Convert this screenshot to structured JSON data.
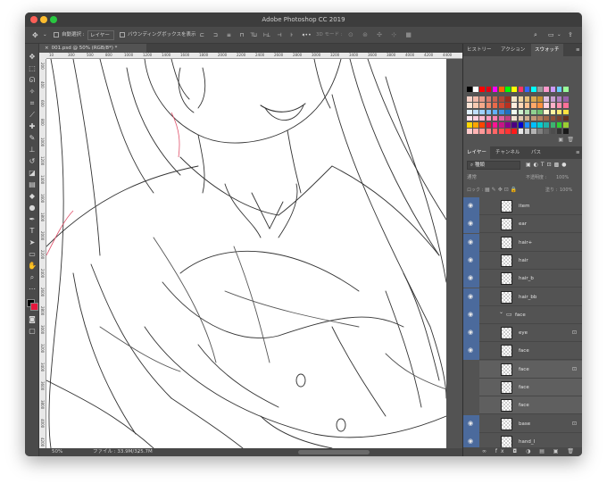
{
  "window": {
    "title": "Adobe Photoshop CC 2019"
  },
  "options_bar": {
    "auto_select_label": "自動選択 :",
    "auto_select_value": "レイヤー",
    "bounding_box_label": "バウンディングボックスを表示",
    "mode_3d_label": "3D モード :"
  },
  "document": {
    "tab_label": "001.psd @ 50% (RGB/8*) *",
    "ruler_h": [
      "10",
      "300",
      "500",
      "800",
      "1000",
      "1200",
      "1400",
      "1600",
      "1800",
      "2000",
      "2200",
      "2400",
      "2600",
      "2800",
      "3000",
      "3200",
      "3400",
      "3600",
      "3800",
      "4000",
      "4200",
      "4400"
    ],
    "ruler_v": [
      "200",
      "400",
      "600",
      "800",
      "1000",
      "1200",
      "1400",
      "1600",
      "1800",
      "2000",
      "2200",
      "2400",
      "2600",
      "2800",
      "3000",
      "3200",
      "3400",
      "3600",
      "3800",
      "4000",
      "4200"
    ]
  },
  "status_bar": {
    "zoom": "50%",
    "file_info": "ファイル : 33.9M/325.7M"
  },
  "swatches_panel": {
    "tabs": [
      "ヒストリー",
      "アクション",
      "スウォッチ"
    ],
    "active_tab": "スウォッチ",
    "colors": [
      "#000000",
      "#ffffff",
      "#ff0000",
      "#e60012",
      "#ff00ff",
      "#ff6600",
      "#00ff00",
      "#ffff00",
      "#ff3366",
      "#3366ff",
      "#00ffff",
      "#999999",
      "#ff99cc",
      "#cc99ff",
      "#66ccff",
      "#99ff99",
      "#f5d0c5",
      "#f0b8a8",
      "#e89a88",
      "#d97a6a",
      "#c86050",
      "#b04838",
      "#983020",
      "#f5e6c8",
      "#efd3a0",
      "#e6bf78",
      "#d9a850",
      "#c89030",
      "#e0c0e0",
      "#c8a0d0",
      "#b080c0",
      "#9860a8",
      "#fce4d6",
      "#f8c9b0",
      "#f4a98a",
      "#ef8a6a",
      "#e86a4a",
      "#d04830",
      "#b83020",
      "#ffeedd",
      "#ffd8b8",
      "#ffc090",
      "#ffa868",
      "#ff9040",
      "#ffd0e0",
      "#ffb0c8",
      "#ff90b0",
      "#ff7098",
      "#e0f0ff",
      "#c0e0ff",
      "#a0d0ff",
      "#80c0ff",
      "#60b0ff",
      "#4090e0",
      "#2070c0",
      "#f0fff0",
      "#d0f0d0",
      "#b0e0b0",
      "#90d090",
      "#70c070",
      "#fff8d0",
      "#fff0a0",
      "#ffe870",
      "#ffe040",
      "#ffe8f0",
      "#ffd0e0",
      "#ffb8d0",
      "#ff9cc0",
      "#ff80b0",
      "#e060a0",
      "#c04080",
      "#f0e0d0",
      "#e0c8b0",
      "#d0b090",
      "#c09878",
      "#b08060",
      "#a06848",
      "#905038",
      "#784030",
      "#603020",
      "#ffd700",
      "#ffa500",
      "#ff4500",
      "#dc143c",
      "#ff1493",
      "#c71585",
      "#8b008b",
      "#4b0082",
      "#0000cd",
      "#1e90ff",
      "#00bfff",
      "#00ced1",
      "#20b2aa",
      "#3cb371",
      "#32cd32",
      "#9acd32",
      "#ffcccc",
      "#ffb3b3",
      "#ff9999",
      "#ff8080",
      "#ff6666",
      "#ff4d4d",
      "#ff3333",
      "#ff1a1a",
      "#e6e6e6",
      "#cccccc",
      "#b3b3b3",
      "#808080",
      "#666666",
      "#4d4d4d",
      "#333333",
      "#1a1a1a"
    ]
  },
  "layers_panel": {
    "tabs": [
      "レイヤー",
      "チャンネル",
      "パス"
    ],
    "active_tab": "レイヤー",
    "kind_filter": "種類",
    "blend_mode": "通常",
    "opacity_label": "不透明度 :",
    "opacity_value": "100%",
    "lock_label": "ロック :",
    "fill_label": "塗り :",
    "fill_value": "100%",
    "layers": [
      {
        "name": "item",
        "visible": true,
        "selected": false,
        "locked": false,
        "group": false
      },
      {
        "name": "ear",
        "visible": true,
        "selected": false,
        "locked": false,
        "group": false
      },
      {
        "name": "hair+",
        "visible": true,
        "selected": false,
        "locked": false,
        "group": false
      },
      {
        "name": "hair",
        "visible": true,
        "selected": false,
        "locked": false,
        "group": false
      },
      {
        "name": "hair_b",
        "visible": true,
        "selected": false,
        "locked": false,
        "group": false
      },
      {
        "name": "hair_bb",
        "visible": true,
        "selected": false,
        "locked": false,
        "group": false
      },
      {
        "name": "face",
        "visible": true,
        "selected": false,
        "locked": false,
        "group": true
      },
      {
        "name": "eye",
        "visible": true,
        "selected": false,
        "locked": true,
        "group": false
      },
      {
        "name": "face",
        "visible": true,
        "selected": false,
        "locked": false,
        "group": false
      },
      {
        "name": "face",
        "visible": false,
        "selected": true,
        "locked": true,
        "group": false
      },
      {
        "name": "face",
        "visible": false,
        "selected": true,
        "locked": false,
        "group": false
      },
      {
        "name": "face",
        "visible": false,
        "selected": true,
        "locked": false,
        "group": false
      },
      {
        "name": "base",
        "visible": true,
        "selected": false,
        "locked": true,
        "group": false
      },
      {
        "name": "hand_l",
        "visible": true,
        "selected": false,
        "locked": false,
        "group": false
      }
    ]
  }
}
